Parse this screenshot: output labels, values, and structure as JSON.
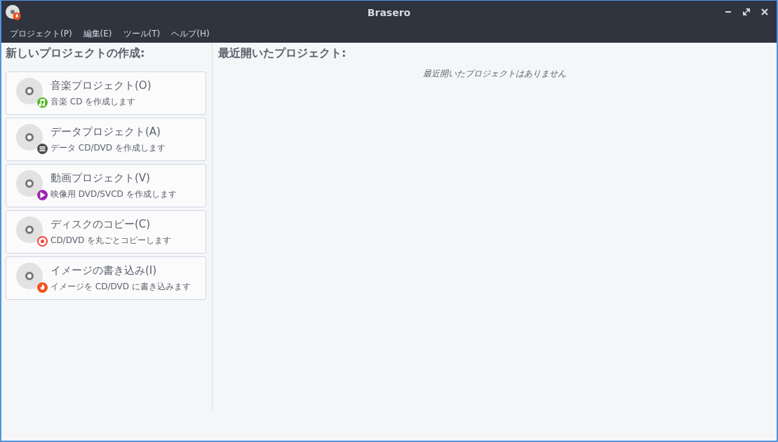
{
  "window": {
    "title": "Brasero"
  },
  "menu": [
    "プロジェクト(P)",
    "編集(E)",
    "ツール(T)",
    "ヘルプ(H)"
  ],
  "new_project": {
    "heading": "新しいプロジェクトの作成:",
    "items": [
      {
        "kind": "music",
        "title": "音楽プロジェクト(O)",
        "description": "音楽 CD を作成します"
      },
      {
        "kind": "data",
        "title": "データプロジェクト(A)",
        "description": "データ CD/DVD を作成します"
      },
      {
        "kind": "video",
        "title": "動画プロジェクト(V)",
        "description": "映像用 DVD/SVCD を作成します"
      },
      {
        "kind": "copy",
        "title": "ディスクのコピー(C)",
        "description": "CD/DVD を丸ごとコピーします"
      },
      {
        "kind": "burn",
        "title": "イメージの書き込み(I)",
        "description": "イメージを CD/DVD に書き込みます"
      }
    ]
  },
  "recent": {
    "heading": "最近開いたプロジェクト:",
    "empty_message": "最近開いたプロジェクトはありません"
  }
}
